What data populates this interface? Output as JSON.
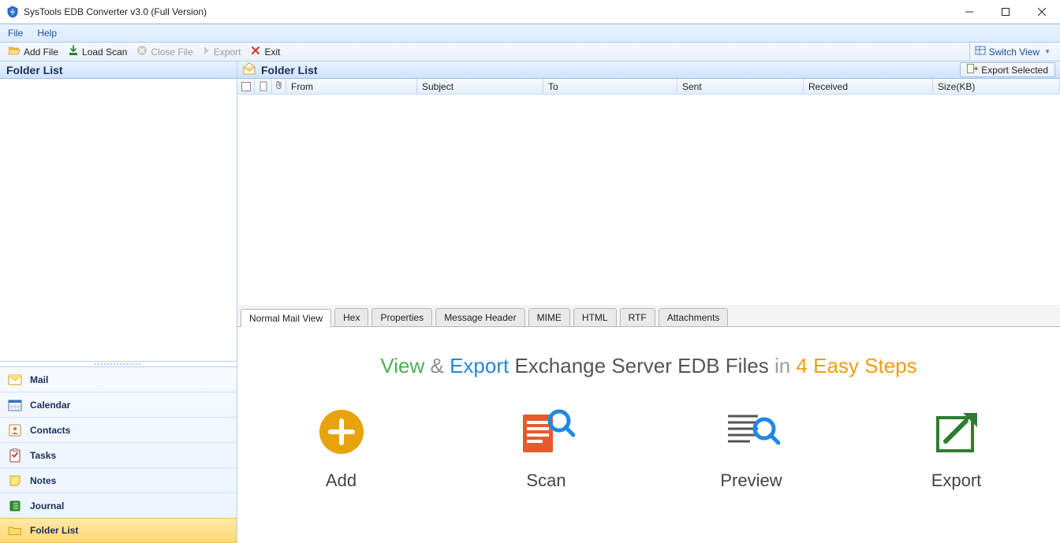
{
  "titlebar": {
    "title": "SysTools EDB Converter v3.0 (Full Version)"
  },
  "menu": {
    "file": "File",
    "help": "Help"
  },
  "toolbar": {
    "add_file": "Add File",
    "load_scan": "Load Scan",
    "close_file": "Close File",
    "export": "Export",
    "exit": "Exit",
    "switch_view": "Switch View"
  },
  "left_panel": {
    "title": "Folder List"
  },
  "nav": {
    "mail": "Mail",
    "calendar": "Calendar",
    "contacts": "Contacts",
    "tasks": "Tasks",
    "notes": "Notes",
    "journal": "Journal",
    "folder_list": "Folder List"
  },
  "right_panel": {
    "title": "Folder List",
    "export_selected": "Export Selected",
    "columns": {
      "from": "From",
      "subject": "Subject",
      "to": "To",
      "sent": "Sent",
      "received": "Received",
      "size": "Size(KB)"
    }
  },
  "tabs": {
    "normal": "Normal Mail View",
    "hex": "Hex",
    "properties": "Properties",
    "message_header": "Message Header",
    "mime": "MIME",
    "html": "HTML",
    "rtf": "RTF",
    "attachments": "Attachments"
  },
  "hero": {
    "w1": "View",
    "amp": "&",
    "w2": "Export",
    "w3": "Exchange Server EDB Files",
    "w4": "in",
    "w5": "4 Easy Steps"
  },
  "steps": {
    "add": "Add",
    "scan": "Scan",
    "preview": "Preview",
    "export": "Export"
  }
}
